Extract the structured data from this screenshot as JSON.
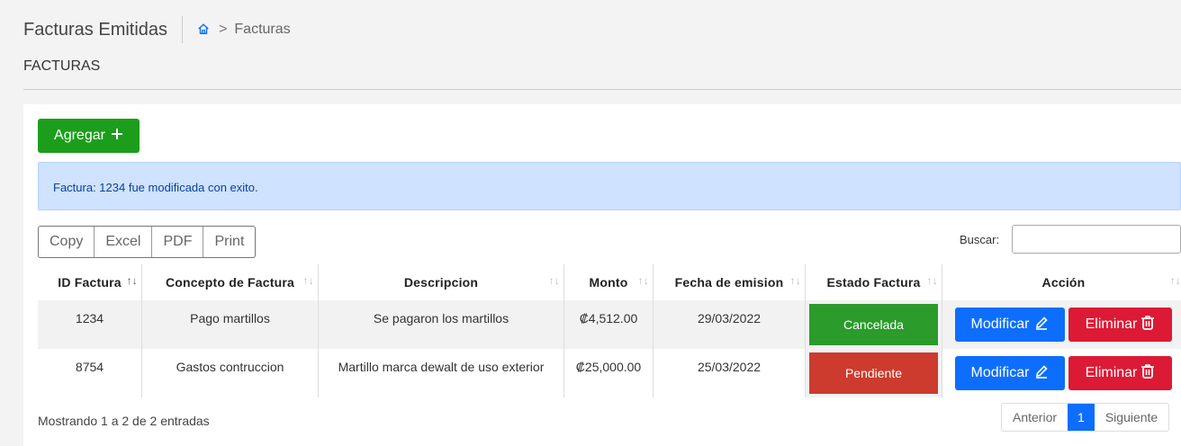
{
  "header": {
    "title": "Facturas Emitidas",
    "breadcrumb": "Facturas",
    "home_icon": "home-icon"
  },
  "subtitle": "FACTURAS",
  "toolbar": {
    "add_label": "Agregar"
  },
  "alert": {
    "message": "Factura: 1234 fue modificada con exito."
  },
  "export": {
    "copy": "Copy",
    "excel": "Excel",
    "pdf": "PDF",
    "print": "Print"
  },
  "search": {
    "label": "Buscar:",
    "value": ""
  },
  "table": {
    "columns": [
      "ID Factura",
      "Concepto de Factura",
      "Descripcion",
      "Monto",
      "Fecha de emision",
      "Estado Factura",
      "Acción"
    ],
    "rows": [
      {
        "id": "1234",
        "concepto": "Pago martillos",
        "descripcion": "Se pagaron los martillos",
        "monto": "₡4,512.00",
        "fecha": "29/03/2022",
        "estado": "Cancelada"
      },
      {
        "id": "8754",
        "concepto": "Gastos contruccion",
        "descripcion": "Martillo marca dewalt de uso exterior",
        "monto": "₡25,000.00",
        "fecha": "25/03/2022",
        "estado": "Pendiente"
      }
    ],
    "modify_label": "Modificar",
    "delete_label": "Eliminar"
  },
  "footer": {
    "info": "Mostrando 1 a 2 de 2 entradas"
  },
  "pagination": {
    "prev": "Anterior",
    "current": "1",
    "next": "Siguiente"
  },
  "colors": {
    "add": "#1c9e1c",
    "primary": "#0d6efd",
    "danger": "#dc1a35",
    "cancelada": "#2b9b2b",
    "pendiente": "#cc3b2d"
  }
}
